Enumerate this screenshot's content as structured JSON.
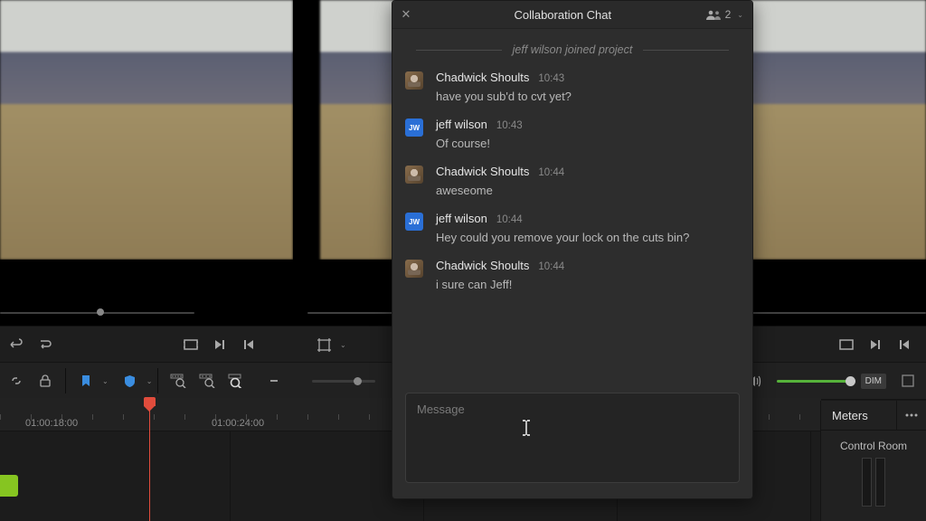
{
  "chat": {
    "title": "Collaboration Chat",
    "people_count": "2",
    "join_text": "jeff wilson joined project",
    "input_placeholder": "Message",
    "messages": [
      {
        "name": "Chadwick Shoults",
        "time": "10:43",
        "text": "have you sub'd to cvt yet?",
        "avatar": "cs"
      },
      {
        "name": "jeff wilson",
        "time": "10:43",
        "text": "Of course!",
        "avatar": "jw"
      },
      {
        "name": "Chadwick Shoults",
        "time": "10:44",
        "text": "aweseome",
        "avatar": "cs"
      },
      {
        "name": "jeff wilson",
        "time": "10:44",
        "text": "Hey could you remove your lock on the cuts bin?",
        "avatar": "jw"
      },
      {
        "name": "Chadwick Shoults",
        "time": "10:44",
        "text": "i sure can Jeff!",
        "avatar": "cs"
      }
    ],
    "jw_initials": "JW"
  },
  "timeline": {
    "tc1": "01:00:18:00",
    "tc2": "01:00:24:00"
  },
  "meters": {
    "title": "Meters",
    "control_room": "Control Room"
  },
  "toolbar": {
    "dim_label": "DIM"
  }
}
